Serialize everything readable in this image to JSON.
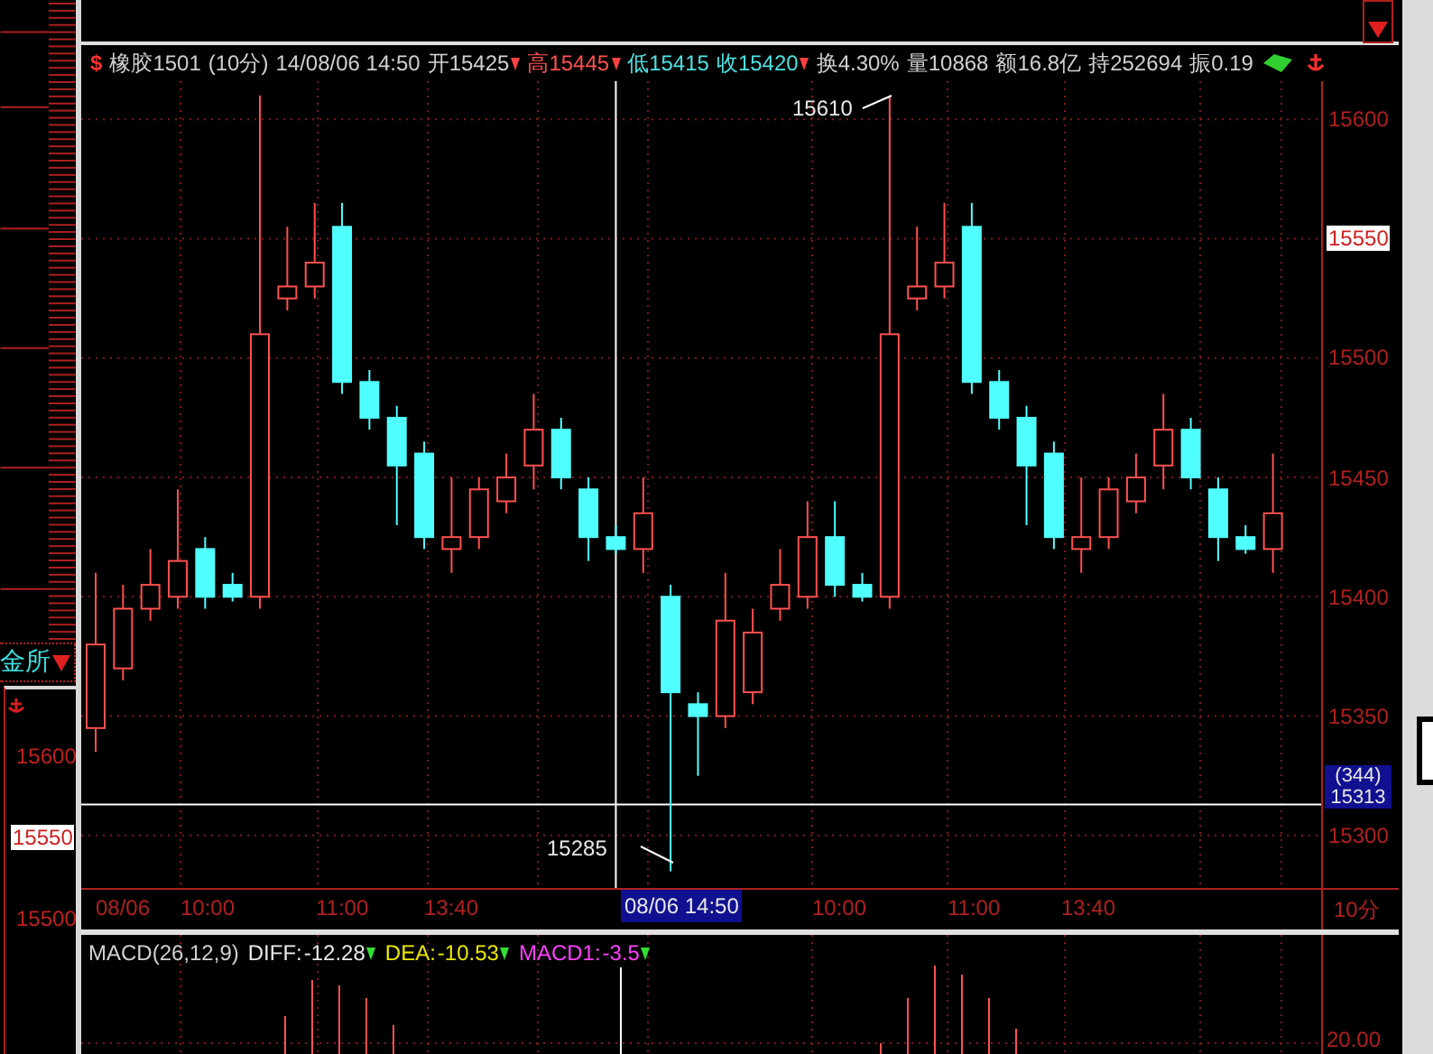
{
  "left_panel": {
    "label": "金所",
    "axis_labels": [
      {
        "text": "15600",
        "highlighted": false
      },
      {
        "text": "15550",
        "highlighted": true
      },
      {
        "text": "15500",
        "highlighted": false
      }
    ]
  },
  "quote_header": {
    "icon_text": "$",
    "symbol": "橡胶1501",
    "period": "(10分)",
    "datetime": "14/08/06 14:50",
    "fields": [
      {
        "label": "开",
        "value": "15425",
        "color": "#d0d0d0",
        "marker": true
      },
      {
        "label": "高",
        "value": "15445",
        "color": "#ff5050",
        "marker": true
      },
      {
        "label": "低",
        "value": "15415",
        "color": "#50e0e0",
        "marker": false
      },
      {
        "label": "收",
        "value": "15420",
        "color": "#50e0e0",
        "marker": true
      },
      {
        "label": "换",
        "value": "4.30%",
        "color": "#d0d0d0",
        "marker": false
      },
      {
        "label": "量",
        "value": "10868",
        "color": "#d0d0d0",
        "marker": false
      },
      {
        "label": "额",
        "value": "16.8亿",
        "color": "#d0d0d0",
        "marker": false
      },
      {
        "label": "持",
        "value": "252694",
        "color": "#d0d0d0",
        "marker": false
      },
      {
        "label": "振",
        "value": "0.19",
        "color": "#d0d0d0",
        "marker": false
      }
    ]
  },
  "price_chart": {
    "tick_highlighted": [
      false,
      true,
      false,
      false,
      false,
      false,
      false
    ],
    "chart_data": {
      "type": "candlestick",
      "ohlc": [
        [
          15345,
          15410,
          15335,
          15380
        ],
        [
          15370,
          15405,
          15365,
          15395
        ],
        [
          15395,
          15420,
          15390,
          15405
        ],
        [
          15400,
          15445,
          15395,
          15415
        ],
        [
          15420,
          15425,
          15395,
          15400
        ],
        [
          15405,
          15410,
          15398,
          15400
        ],
        [
          15400,
          15610,
          15395,
          15510
        ],
        [
          15525,
          15555,
          15520,
          15530
        ],
        [
          15530,
          15565,
          15525,
          15540
        ],
        [
          15555,
          15565,
          15485,
          15490
        ],
        [
          15490,
          15495,
          15470,
          15475
        ],
        [
          15475,
          15480,
          15430,
          15455
        ],
        [
          15460,
          15465,
          15420,
          15425
        ],
        [
          15420,
          15450,
          15410,
          15425
        ],
        [
          15425,
          15450,
          15420,
          15445
        ],
        [
          15440,
          15460,
          15435,
          15450
        ],
        [
          15455,
          15485,
          15445,
          15470
        ],
        [
          15470,
          15475,
          15445,
          15450
        ],
        [
          15445,
          15450,
          15415,
          15425
        ],
        [
          15425,
          15430,
          15418,
          15420
        ],
        [
          15420,
          15450,
          15410,
          15435
        ],
        [
          15400,
          15405,
          15285,
          15360
        ],
        [
          15355,
          15360,
          15325,
          15350
        ],
        [
          15350,
          15410,
          15345,
          15390
        ],
        [
          15360,
          15395,
          15355,
          15385
        ],
        [
          15395,
          15420,
          15390,
          15405
        ],
        [
          15400,
          15440,
          15395,
          15425
        ],
        [
          15425,
          15440,
          15400,
          15405
        ],
        [
          15405,
          15410,
          15398,
          15400
        ],
        [
          15400,
          15610,
          15395,
          15510
        ],
        [
          15525,
          15555,
          15520,
          15530
        ],
        [
          15530,
          15565,
          15525,
          15540
        ],
        [
          15555,
          15565,
          15485,
          15490
        ],
        [
          15490,
          15495,
          15470,
          15475
        ],
        [
          15475,
          15480,
          15430,
          15455
        ],
        [
          15460,
          15465,
          15420,
          15425
        ],
        [
          15420,
          15450,
          15410,
          15425
        ],
        [
          15425,
          15450,
          15420,
          15445
        ],
        [
          15440,
          15460,
          15435,
          15450
        ],
        [
          15455,
          15485,
          15445,
          15470
        ],
        [
          15470,
          15475,
          15445,
          15450
        ],
        [
          15445,
          15450,
          15415,
          15425
        ],
        [
          15425,
          15430,
          15418,
          15420
        ],
        [
          15420,
          15460,
          15410,
          15435
        ]
      ],
      "yticks": [
        15600,
        15550,
        15500,
        15450,
        15400,
        15350,
        15300
      ],
      "ylim": [
        15278,
        15616
      ],
      "grid": true,
      "ref_lines": [
        {
          "axis": "y",
          "value": 15313
        }
      ]
    },
    "crosshair_label": {
      "bars": "(344)",
      "price": "15313"
    },
    "annotations": [
      "15610",
      "15285"
    ],
    "time_labels": [
      {
        "text": "08/06",
        "selected": false
      },
      {
        "text": "10:00",
        "selected": false
      },
      {
        "text": "11:00",
        "selected": false
      },
      {
        "text": "13:40",
        "selected": false
      },
      {
        "text": "08/06 14:50",
        "selected": true
      },
      {
        "text": "10:00",
        "selected": false
      },
      {
        "text": "11:00",
        "selected": false
      },
      {
        "text": "13:40",
        "selected": false
      }
    ],
    "period_label": "10分"
  },
  "macd": {
    "title": "MACD(26,12,9)",
    "fields": [
      {
        "label": "DIFF:",
        "value": "-12.28",
        "color": "#e8e8e8"
      },
      {
        "label": "DEA:",
        "value": "-10.53",
        "color": "#e8e800"
      },
      {
        "label": "MACD1:",
        "value": "-3.5",
        "color": "#ff40ff"
      }
    ],
    "axis_label": "20.00"
  }
}
